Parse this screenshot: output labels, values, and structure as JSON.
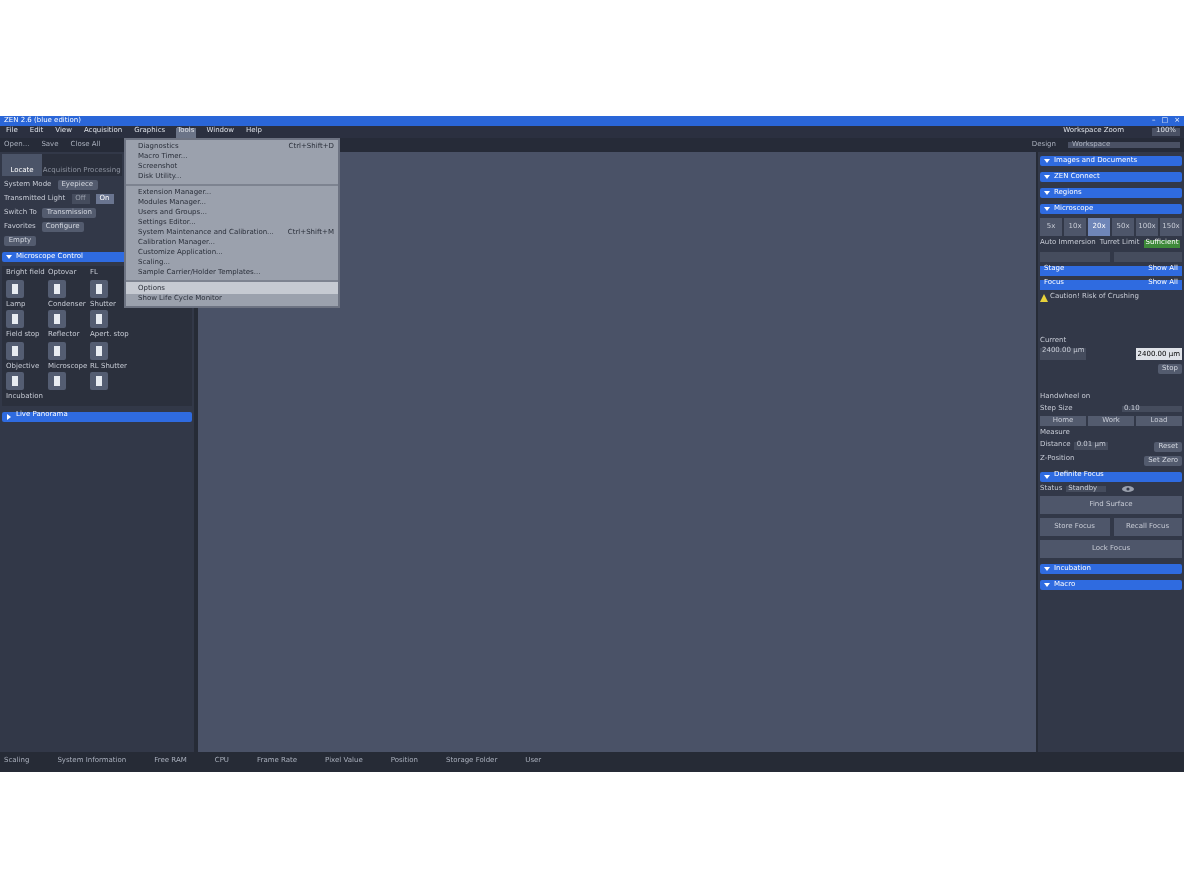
{
  "window": {
    "title": "ZEN 2.6 (blue edition)",
    "controls": [
      "–",
      "□",
      "×"
    ]
  },
  "menu": [
    {
      "label": "File",
      "selected": false
    },
    {
      "label": "Edit",
      "selected": false
    },
    {
      "label": "View",
      "selected": false
    },
    {
      "label": "Acquisition",
      "selected": false
    },
    {
      "label": "Graphics",
      "selected": false
    },
    {
      "label": "Tools",
      "selected": true
    },
    {
      "label": "Window",
      "selected": false
    },
    {
      "label": "Help",
      "selected": false
    }
  ],
  "workspace_zoom": {
    "label": "Workspace Zoom",
    "value": "100%"
  },
  "toolbar": [
    "Open...",
    "Save",
    "Close All"
  ],
  "design": {
    "label": "Design",
    "workspace": "Workspace"
  },
  "tabs": [
    {
      "label": "Locate",
      "selected": true
    },
    {
      "label": "Acquisition",
      "selected": false
    },
    {
      "label": "Processing",
      "selected": false
    }
  ],
  "left": {
    "system_mode": {
      "label": "System Mode",
      "value": "Eyepiece"
    },
    "transmitted_light": {
      "label": "Transmitted Light",
      "options": [
        {
          "label": "Off",
          "selected": false
        },
        {
          "label": "On",
          "selected": true
        }
      ]
    },
    "switch_to": {
      "label": "Switch To",
      "value": "Transmission"
    },
    "favorites": {
      "label": "Favorites",
      "button": "Configure"
    },
    "empty": "Empty",
    "sections": [
      {
        "title": "Microscope Control",
        "expanded": true
      },
      {
        "title": "Live Panorama",
        "expanded": false
      }
    ],
    "controls": [
      {
        "label": "Bright field"
      },
      {
        "label": "Optovar"
      },
      {
        "label": "FL"
      },
      {
        "label": "Lamp"
      },
      {
        "label": "Condenser"
      },
      {
        "label": "Shutter"
      },
      {
        "label": "Field stop"
      },
      {
        "label": "Reflector"
      },
      {
        "label": "Apert. stop"
      },
      {
        "label": "Objective"
      },
      {
        "label": "Microscope"
      },
      {
        "label": "RL Shutter"
      }
    ],
    "incubation": "Incubation"
  },
  "tools_menu": [
    {
      "label": "Diagnostics",
      "shortcut": "Ctrl+Shift+D",
      "divider_above": false,
      "selected": false
    },
    {
      "label": "Macro Timer...",
      "divider_above": false,
      "selected": false
    },
    {
      "label": "Screenshot",
      "divider_above": false,
      "selected": false
    },
    {
      "label": "Disk Utility...",
      "divider_above": false,
      "selected": false
    },
    {
      "label": "Extension Manager...",
      "divider_above": true,
      "selected": false
    },
    {
      "label": "Modules Manager...",
      "divider_above": false,
      "selected": false
    },
    {
      "label": "Users and Groups...",
      "divider_above": false,
      "selected": false
    },
    {
      "label": "Settings Editor...",
      "divider_above": false,
      "selected": false
    },
    {
      "label": "System Maintenance and Calibration...",
      "shortcut": "Ctrl+Shift+M",
      "divider_above": false,
      "selected": false
    },
    {
      "label": "Calibration Manager...",
      "divider_above": false,
      "selected": false
    },
    {
      "label": "Customize Application...",
      "divider_above": false,
      "selected": false
    },
    {
      "label": "Scaling...",
      "divider_above": false,
      "selected": false
    },
    {
      "label": "Sample Carrier/Holder Templates...",
      "divider_above": false,
      "selected": false
    },
    {
      "label": "Options",
      "divider_above": true,
      "selected": true
    },
    {
      "label": "Show Life Cycle Monitor",
      "divider_above": false,
      "selected": false
    }
  ],
  "right": {
    "sections": [
      {
        "title": "Images and Documents"
      },
      {
        "title": "ZEN Connect"
      },
      {
        "title": "Regions"
      },
      {
        "title": "Microscope"
      }
    ],
    "objectives": [
      {
        "label": "5x",
        "selected": false
      },
      {
        "label": "10x",
        "selected": false
      },
      {
        "label": "20x",
        "selected": true
      },
      {
        "label": "50x",
        "selected": false
      },
      {
        "label": "100x",
        "selected": false
      },
      {
        "label": "150x",
        "selected": false
      }
    ],
    "auto_immersion": "Auto Immersion",
    "turret_limit": "Turret Limit",
    "sufficient": "Sufficient",
    "stage": "Stage",
    "stage_show_all": "Show All",
    "focus": "Focus",
    "focus_show_all": "Show All",
    "caution": "Caution! Risk of Crushing",
    "current_label": "Current",
    "current": "2400.00 µm",
    "target": "2400.00 µm",
    "stop": "Stop",
    "handwheel": "Handwheel on",
    "step_label": "Step Size",
    "step": "0.10",
    "moves": [
      "Home",
      "Work",
      "Load"
    ],
    "measure": "Measure",
    "distance_label": "Distance",
    "distance": "0.01 µm",
    "reset": "Reset",
    "z_label": "Z-Position",
    "set_zero": "Set Zero",
    "definite_focus": "Definite Focus",
    "status_label": "Status",
    "status": "Standby",
    "actions": [
      "Find Surface",
      "Store Focus",
      "Recall Focus",
      "Lock Focus"
    ],
    "bottom_sections": [
      {
        "title": "Incubation"
      },
      {
        "title": "Macro"
      }
    ]
  },
  "status_bar": [
    "Scaling",
    "System Information",
    "Free RAM",
    "CPU",
    "Frame Rate",
    "Pixel Value",
    "Position",
    "Storage Folder",
    "User"
  ]
}
